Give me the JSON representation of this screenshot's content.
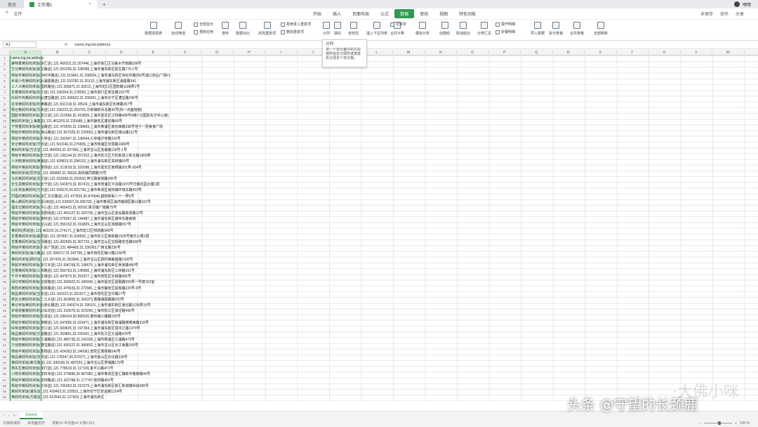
{
  "titlebar": {
    "home_tab": "首页",
    "file_tab": "工作簿1",
    "add_tab": "+",
    "user": "嘿嘿"
  },
  "menubar": {
    "file": "文件",
    "center_tabs": [
      "开始",
      "插入",
      "页面布局",
      "公式",
      "数据",
      "审阅",
      "视图",
      "特色功能"
    ],
    "active_tab": "数据",
    "right": [
      "未保存",
      "协作",
      "分享"
    ]
  },
  "ribbon": {
    "items": [
      "数据透视表",
      "自动筛选",
      "全部显示",
      "重新应用",
      "排序",
      "数据对比",
      "高亮重复项",
      "删除重复项",
      "拒绝录入重复项",
      "分列",
      "填充",
      "有效性",
      "插入下拉列表",
      "合并计算",
      "记录单",
      "模拟分析",
      "创建组",
      "取消组合",
      "分类汇总",
      "展开明细",
      "折叠明细",
      "导入数据",
      "拆分表格",
      "合并表格",
      "全部刷新"
    ]
  },
  "tooltip": {
    "title": "分列",
    "body": "将一个单元格中的内容按照指定分隔符或宽度拆分成多个单元格。"
  },
  "formula_bar": {
    "cell_ref": "A1",
    "fx": "fx",
    "formula": "name,lng,lat,address"
  },
  "columns": [
    "A",
    "B",
    "C",
    "D",
    "E",
    "F",
    "G",
    "H",
    "I",
    "J",
    "K",
    "L",
    "M",
    "N",
    "O",
    "P",
    "Q",
    "R",
    "S",
    "T",
    "U",
    "V",
    "W",
    "X"
  ],
  "rows": [
    "name,lng,lat,address",
    "蜂味香黄焖鸡米饭(徐汇店),121.456311,31.207446,上海市徐汇区乌鲁木齐南路396号",
    "王记黄焖鸡米饭(民生路店),121.552235,31.238098,上海市浦东新区民生路776-1号",
    "杨铭宇黄焖鸡米饭(世纪中路店),121.519461,31.208504,上海市浦东新区世纪中路256号浦江商业广场F1",
    "步易小吃黄焖鸡米饭(浦建路店),121.533782,31.20132,上海市浦东新区浦建路341",
    "三人众黄焖鸡米饭(国权路店),121.506871,31.30612,上海市虹口区国权路1188弄1号",
    "吉香黄焖鸡米饭(松江店),121.246304,31.178592,上海市闵行区吴宝路1027号",
    "红焖牛肉黄焖鸡米饭(漕宝路店),121.436622,31.206651,上海市长宁区漕宝路246号",
    "名米黄焖鸡米饭(利津路店),121.591318,31.28529,上海市浦东新区利津路357号",
    "杨记黄焖鸡米饭(华新店),121.236222,31.250701,华新镇新浜北路30号(快一点面馆旁)",
    "国胜祥黄焖鸡米饭(张江店),121.212066,31.419839,上海市嘉定区江桥路408号4幢7-2(国际东方中心旁)",
    "黄焖鸡米饭(上海鑫店),121.461203,31.225688,上海市静安区康定路49号",
    "于梵香焖鸡米饭(新昌路店),121.475655,31.238893,上海市黄浦区南京西路338号地下一层美食广场",
    "杨铭宇黄焖鸡米饭(峨山路店),121.557325,31.220663,上海市浦东新区峨山路111号",
    "杨铭宇黄焖鸡米饭(九亭店),121.332947,31.138544,九亭镇沪亭路220号",
    "张记黄焖鸡米饭(华侨店),121.502246,31.276835,上海市杨浦区长阳路1689号",
    "黄焖鸡米饭(万达店),121.456659,31.327465,上海市宝山区淞南路118号-1号",
    "杨铭宇黄焖鸡米饭(大华店),121.195144,31.057202,上海市松江区方松街道三新北路1800弄",
    "小天鹅港米焖鸡(黄浦店),121.428823,31.298132,上海市浦东新区高桥镇69号",
    "杨铭宇黄焖鸡米饭(曹杨店),121.213018,31.329288,上海市嘉定区南翔镇301弄-304号",
    "黄焖鸡米饭(同济店),121.385882,31.35815,高桥镇同德路70号",
    "马氏黄焖鸡米饭(龙华店),121.632958,31.259933,申江路南侧路395号",
    "长生源黄焖鸡米饭(长宁店),121.541873,31.267415,上海市杨浦区平凉路1970号华荣花园大厦1层",
    "山东米饭黄焖鸡(万科店),121.935076,30.921799,上海市奉贤区南桥镇环城东路423号",
    "同福坊黄焖鸡米饭(徐汇文化路店),121.477825,30.876846,越桥新街八十一弄5号",
    "黄山黄焖鸡米饭(华毅186店),121.535697,30.935793,上海市奉贤区海湾镇通匠路公路115号",
    "福本记黄焖鸡米饭(中心店),121.465423,31.06592,吴泾镇广南路75号",
    "杨铭宇黄焖鸡米饭(戏剧场店),121.493127,31.326739,上海市宝山区逸仙路高逸路13号",
    "杨铭宇黄焖鸡米饭(康桥店),121.578367,31.144487,上海市浦东新区康桥东路南侧",
    "杨铭宇黄焖鸡米饭(宝山店),121.356152,31.319829,上海市宝山区城银路567号",
    "黄焖鸡(邦道店),121.481102,31.274171,上海市虹口区邦商路345号",
    "吉香黄焖鸡米饭(曲阳店),121.287897,31.034826,上海市松江区南新路1526号南乐公寓1层",
    "吉香黄焖鸡米饭(宝杨路店),121.402655,31.367733,上海市宝山区宝杨路安吉路568号",
    "杨铭宇黄焖鸡米饭(人民广场店),121.484465,31.236993,广西北路236号",
    "黄焖鸡米饭(海川路店),121.399217,31.247796,上海市普陀区梅川路1240号",
    "黄焖鸡米饭(顾村店),121.397429,31.353949,上海市宝山区顾村镇菊盛路1435号",
    "杨铭宇黄焖鸡米饭(浙江乡店),121.696768,31.198675,上海市浦东新区吴家路480号",
    "吉香黄焖鸡米饭(三林路店),121.506763,31.145856,上海市浦东新区三林路331号",
    "于月半黄焖鸡米饭(车墩店),121.447873,31.291877,上海市普陀区长和路455号",
    "阔仔祥黄焖鸡米饭(宝塔路店),121.264922,31.349349,上海市嘉定区嘉戬路555弄一号楼102室",
    "吴鸦鸡黄焖鸡米饭(嘉和路店),121.476533,31.272981,上海市静安区民和路220号-6号",
    "御品黄焖鸡米饭(宝安店),121.160322,31.301877,上海市普陀区宝华路17号",
    "老友记黄焖鸡米饭(二工大店),121.663855,31.266373,曹路镇顾路路203号",
    "黄记米饭黄焖鸡米饭(通北路店),121.640374,31.295311,上海市浦东新区通北路1135弄15号",
    "步易快餐黄焖鸡米饭(车坊店),121.318075,31.023255,上海市松江区泗泾路495号",
    "杨铭宇黄焖鸡米饭(松泽店),121.246424,30.895526,泰桥镇小镇路105号",
    "杨铭宇黄焖鸡米饭(牌楼店),121.647855,31.029471,上海市浦东新区南浦路牌楼西路318号",
    "好味道黄焖鸡米饭(张江店),121.600825,31.197394,上海市浦东新区祖冲之路1370号",
    "御品黄焖鸡米饭(文涵路店),121.359851,31.035931,上海市松江区文涵路478号",
    "杨铭宇黄焖鸡米饭(江浦路店),121.485735,31.243168,上海市杨浦区江浦路473号",
    "万佳丽黄焖鸡米饭(漕宝路店),121.430127,31.385832,上海市宝山区长江南路243号",
    "杨铭宇黄焖鸡米饭(曹杨店),121.424363,31.246062,普陀区曹杨路540号",
    "御品黄焖鸡米饭(吉祥店),121.178347,30.370271,上海市金山区石化路328号",
    "黄焖鸡米饭(美华路店),121.349199,31.487533,上海市宝山区罗瑞路179号",
    "杨先生黄焖鸡米饭(闵行店),121.778619,31.117109,金平公路471号",
    "小刚日黄焖鸡米饭(龙松米店),121.379886,30.987082,上海市奉贤区金汇镇新丰路泰路49号",
    "杨铭宇黄焖鸡米饭(桂林路店),121.422788,31.177747,桂林路402号",
    "杨铭宇黄焖鸡米饭(红米店),121.706363,31.210279,上海市浦东新区新汇新城镇世尚589号",
    "黄焖鸡米饭(浦东店),121.429463,31.220511,上海市长宁区安远路1224号",
    "黄焖鸡米饭(方晨店),121.612643,31.127433,上海市浦东新区"
  ],
  "sheet_tab": "Sheet1",
  "status": {
    "left": [
      "文档未保护",
      "本地备份开"
    ],
    "stats": "求和=0  平均值=0  计数=151",
    "zoom": "100 %"
  },
  "watermark": "头条 @守望的长颈鹿",
  "watermark2": "·大佛小咪"
}
